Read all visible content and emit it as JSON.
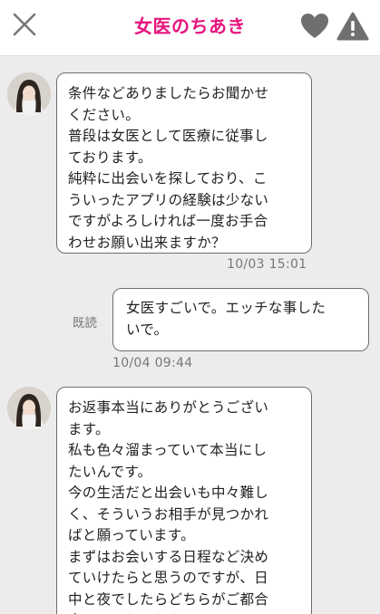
{
  "header": {
    "title": "女医のちあき",
    "accent_color": "#e6167e",
    "icons": [
      "close-icon",
      "heart-icon",
      "warning-icon"
    ]
  },
  "messages": [
    {
      "side": "received",
      "text": "条件などありましたらお聞かせ\nください。\n普段は女医として医療に従事し\nております。\n純粋に出会いを探しており、こ\nういったアプリの経験は少ない\nですがよろしければ一度お手合\nわせお願い出来ますか？",
      "time": "10/03 15:01"
    },
    {
      "side": "sent",
      "read_label": "既読",
      "text": "女医すごいで。エッチな事した\nいで。",
      "time": "10/04 09:44"
    },
    {
      "side": "received",
      "text": "お返事本当にありがとうござい\nます。\n私も色々溜まっていて本当にし\nたいんです。\n今の生活だと出会いも中々難し\nく、そういうお相手が見つかれ\nばと願っています。\nまずはお会いする日程など決め\nていけたらと思うのですが、日\n中と夜でしたらどちらがご都合\n良いのでしょうか？"
    }
  ]
}
